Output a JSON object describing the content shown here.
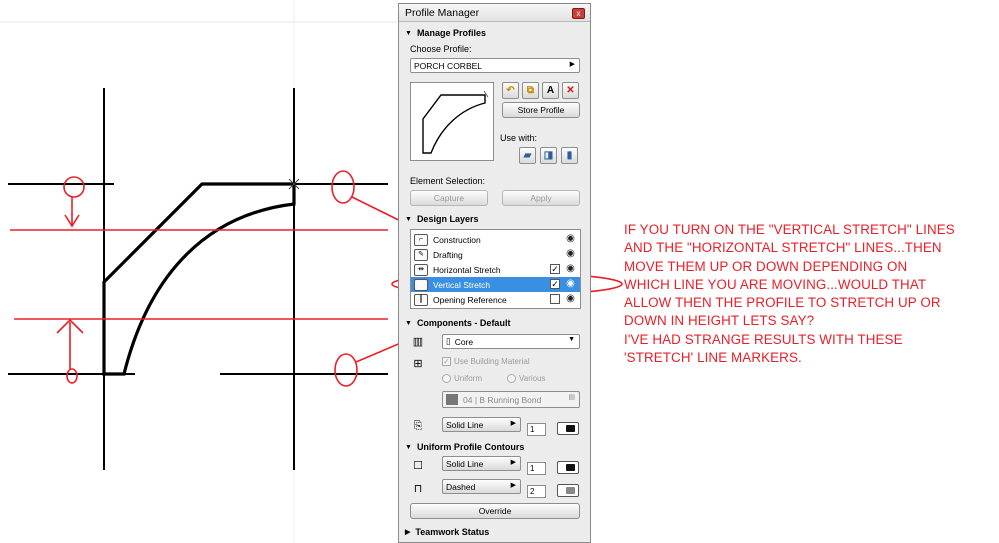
{
  "panel": {
    "title": "Profile Manager",
    "close_glyph": "x",
    "manage_profiles": {
      "header": "Manage Profiles",
      "choose_label": "Choose Profile:",
      "profile_value": "PORCH CORBEL",
      "store_button": "Store Profile",
      "use_with_label": "Use with:",
      "element_selection_label": "Element Selection:",
      "capture_button": "Capture",
      "apply_button": "Apply"
    },
    "design_layers": {
      "header": "Design Layers",
      "items": [
        {
          "label": "Construction",
          "icon": "construction-layer-icon",
          "checkbox": false,
          "checked": false,
          "selected": false
        },
        {
          "label": "Drafting",
          "icon": "drafting-layer-icon",
          "checkbox": false,
          "checked": false,
          "selected": false
        },
        {
          "label": "Horizontal Stretch",
          "icon": "horizontal-stretch-icon",
          "checkbox": true,
          "checked": true,
          "selected": false
        },
        {
          "label": "Vertical Stretch",
          "icon": "vertical-stretch-icon",
          "checkbox": true,
          "checked": true,
          "selected": true
        },
        {
          "label": "Opening Reference",
          "icon": "opening-reference-icon",
          "checkbox": true,
          "checked": false,
          "selected": false
        }
      ]
    },
    "components": {
      "header": "Components - Default",
      "component_value": "Core",
      "use_building_material": "Use Building Material",
      "uniform_option": "Uniform",
      "various_option": "Various",
      "material_value": "04 | B Running Bond",
      "line_type": "Solid Line",
      "line_pen": "1"
    },
    "contours": {
      "header": "Uniform Profile Contours",
      "line1_type": "Solid Line",
      "line1_pen": "1",
      "line2_type": "Dashed",
      "line2_pen": "2",
      "override_button": "Override"
    },
    "teamwork": {
      "header": "Teamwork Status"
    }
  },
  "annotation": {
    "color": "#e8202a",
    "lines": [
      "IF YOU TURN ON THE \"VERTICAL STRETCH\" LINES",
      "AND THE \"HORIZONTAL STRETCH\" LINES...THEN",
      "MOVE THEM UP OR DOWN DEPENDING ON",
      "WHICH LINE YOU ARE MOVING...WOULD THAT",
      "ALLOW THEN THE PROFILE TO STRETCH UP OR",
      "DOWN IN HEIGHT LETS SAY?",
      "I'VE HAD STRANGE RESULTS WITH THESE",
      "'STRETCH' LINE MARKERS."
    ]
  },
  "colors": {
    "selection": "#3a8fe0",
    "annotation_red": "#e8202a",
    "panel_bg": "#ececec"
  }
}
